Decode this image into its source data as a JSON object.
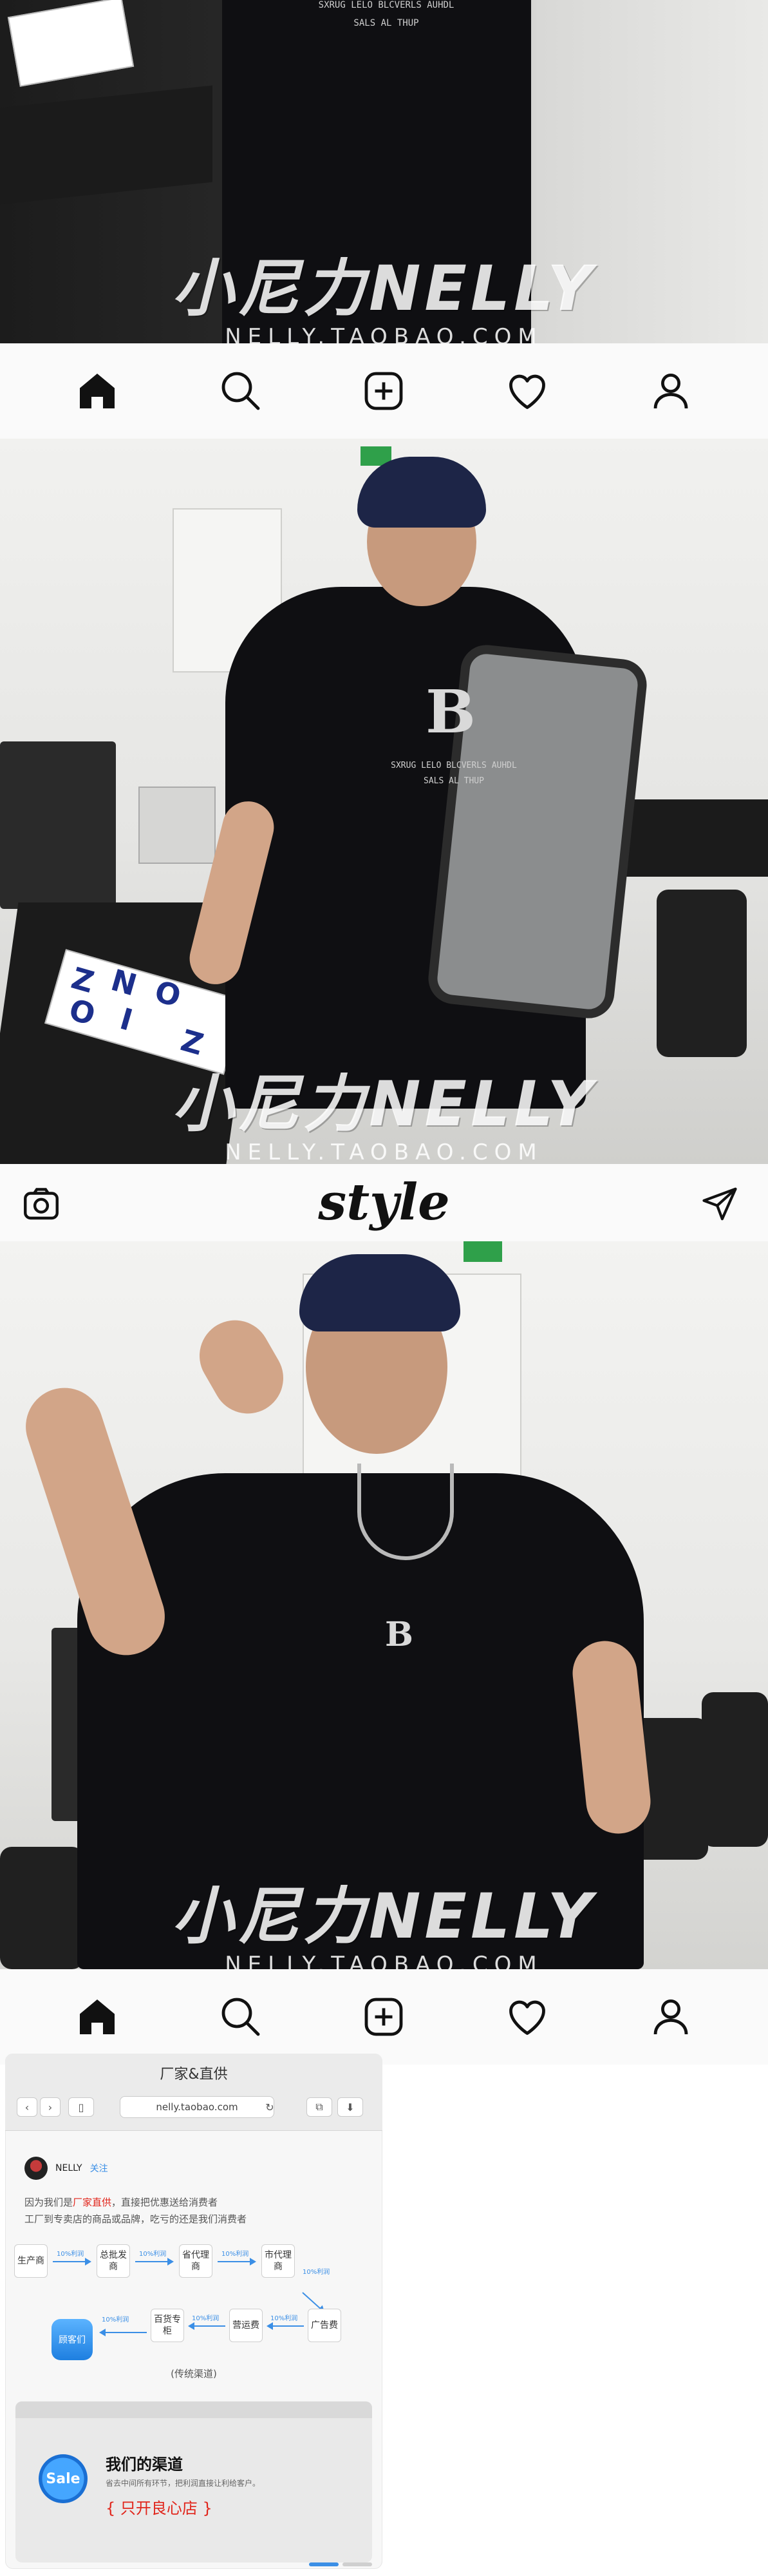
{
  "colors": {
    "shirt": "#0f0f12",
    "cap": "#1d2547",
    "accent_red": "#e1251b",
    "accent_blue": "#3b8fe6",
    "bar_bg": "#fafafa"
  },
  "photo1": {
    "chest_text_1": "SXRUG LELO BLCVERLS AUHDL",
    "chest_text_2": "SALS AL THUP",
    "watermark_brand": "小尼力NELLY",
    "watermark_site": "NELLY.TAOBAO.COM"
  },
  "nav_bar_1": {
    "icons": [
      "home-icon",
      "search-icon",
      "add-icon",
      "heart-icon",
      "profile-icon"
    ]
  },
  "photo2": {
    "chest_logo": "B",
    "chest_text_1": "SXRUG LELO BLCVERLS AUHDL",
    "chest_text_2": "SALS AL THUP",
    "paper_letters": [
      "Z",
      "N",
      "O",
      "I",
      "O",
      "Z"
    ],
    "watermark_brand": "小尼力NELLY",
    "watermark_site": "NELLY.TAOBAO.COM"
  },
  "top_bar": {
    "logo": "style",
    "icons": [
      "camera-icon",
      "send-icon"
    ]
  },
  "photo3": {
    "chest_logo": "B",
    "watermark_brand": "小尼力NELLY",
    "watermark_site": "NELLY.TAOBAO.COM"
  },
  "nav_bar_2": {
    "icons": [
      "home-icon",
      "search-icon",
      "add-icon",
      "heart-icon",
      "profile-icon"
    ]
  },
  "browser_card": {
    "window_title": "厂家&直供",
    "url": "nelly.taobao.com",
    "profile_name": "NELLY",
    "profile_follow": "关注",
    "intro_part1": "因为我们是",
    "intro_highlight": "厂家直供",
    "intro_part2": "，直接把优惠送给消费者",
    "intro_line2": "工厂到专卖店的商品或品牌，吃亏的还是我们消费者",
    "flow_row1": [
      "生产商",
      "总批发商",
      "省代理商",
      "市代理商"
    ],
    "flow_row2": [
      "广告费",
      "营运费",
      "百货专柜"
    ],
    "flow_note": "10%利润",
    "consumer": "顾客们",
    "flow_caption": "(传统渠道)",
    "channel_title": "我们的渠道",
    "channel_desc": "省去中间所有环节，把利润直接让利给客户。",
    "channel_shop": "{ 只开良心店 }",
    "sale_badge": "Sale"
  }
}
